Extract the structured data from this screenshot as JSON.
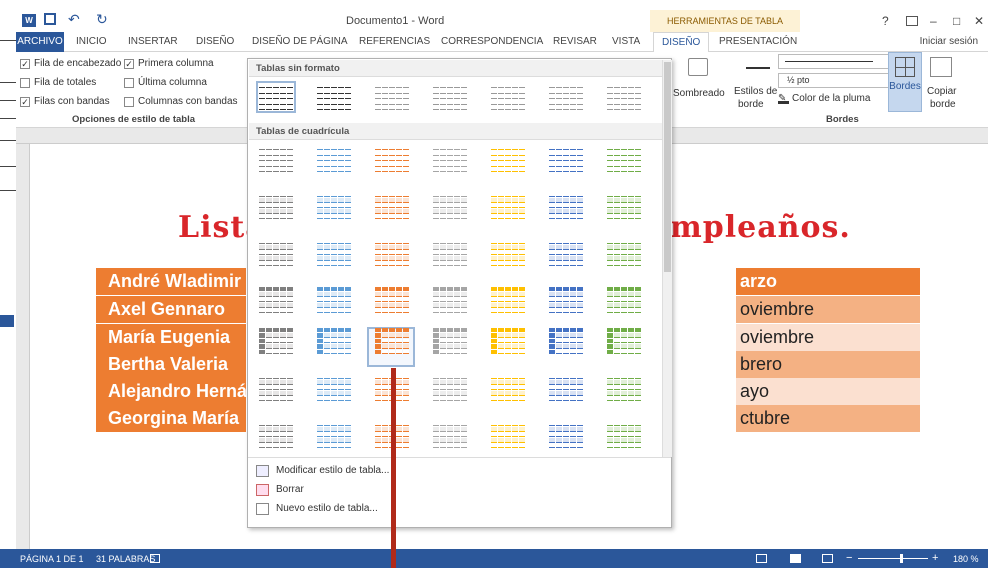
{
  "window": {
    "title": "Documento1 - Word",
    "tools_title": "HERRAMIENTAS DE TABLA",
    "help": "?",
    "minimize": "–",
    "maximize": "□",
    "close": "✕"
  },
  "tabs": [
    {
      "label": "ARCHIVO"
    },
    {
      "label": "INICIO"
    },
    {
      "label": "INSERTAR"
    },
    {
      "label": "DISEÑO"
    },
    {
      "label": "DISEÑO DE PÁGINA"
    },
    {
      "label": "REFERENCIAS"
    },
    {
      "label": "CORRESPONDENCIA"
    },
    {
      "label": "REVISAR"
    },
    {
      "label": "VISTA"
    },
    {
      "label": "DISEÑO"
    },
    {
      "label": "PRESENTACIÓN"
    }
  ],
  "signin": "Iniciar sesión",
  "options": {
    "header_row": "Fila de encabezado",
    "first_column": "Primera columna",
    "total_row": "Fila de totales",
    "last_column": "Última columna",
    "banded_rows": "Filas con bandas",
    "banded_columns": "Columnas con bandas",
    "group_label": "Opciones de estilo de tabla",
    "checked": "✓"
  },
  "ribbon": {
    "shading": "Sombreado",
    "border_styles": "Estilos de",
    "border_styles2": "borde",
    "pen_weight": "½ pto",
    "pen_color": "Color de la pluma",
    "borders": "Bordes",
    "copy_border": "Copiar",
    "copy_border2": "borde",
    "borders_group": "Bordes"
  },
  "gallery": {
    "plain_header": "Tablas sin formato",
    "grid_header": "Tablas de cuadrícula",
    "menu": [
      {
        "label": "Modificar estilo de tabla..."
      },
      {
        "label": "Borrar"
      },
      {
        "label": "Nuevo estilo de tabla..."
      }
    ]
  },
  "document": {
    "title_left": "Lista",
    "title_right": "mpleaños.",
    "rows": [
      {
        "name": "André Wladimir",
        "date": "arzo"
      },
      {
        "name": "Axel Gennaro",
        "date": "oviembre"
      },
      {
        "name": "María Eugenia",
        "date": "oviembre"
      },
      {
        "name": "Bertha Valeria",
        "date": "brero"
      },
      {
        "name": "Alejandro Herná",
        "date": "ayo"
      },
      {
        "name": "Georgina María",
        "date": "ctubre"
      }
    ]
  },
  "status": {
    "page": "PÁGINA 1 DE 1",
    "words": "31 PALABRAS",
    "zoom": "180 %"
  },
  "colors": {
    "accent": "#2b579a",
    "orange": "#ed7d31",
    "title_red": "#d9262a"
  }
}
